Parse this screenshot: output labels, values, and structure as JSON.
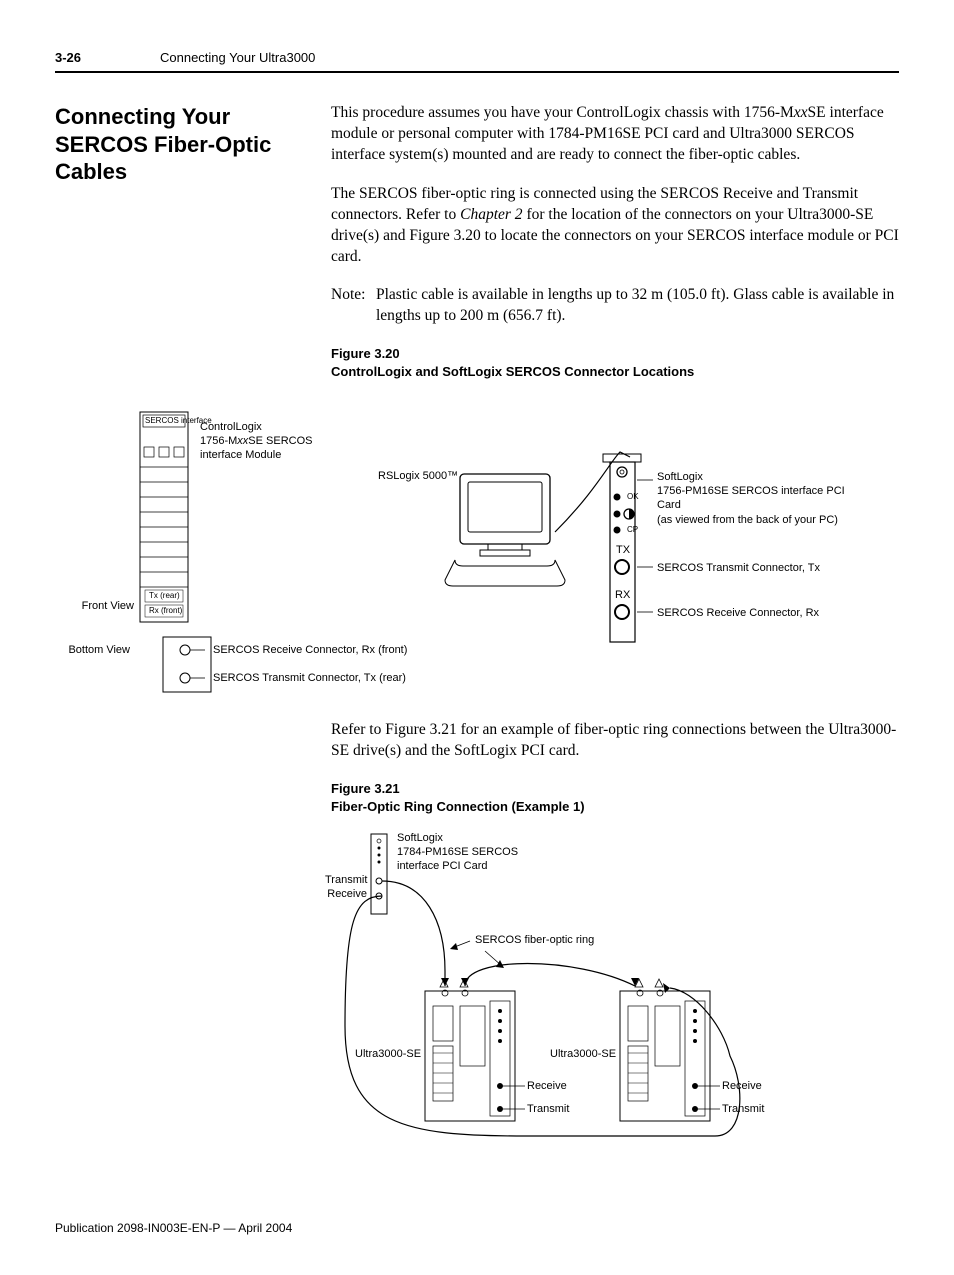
{
  "header": {
    "page_number": "3-26",
    "chapter": "Connecting Your Ultra3000"
  },
  "section_title": "Connecting Your SERCOS Fiber-Optic Cables",
  "para1_a": "This procedure assumes you have your ControlLogix chassis with 1756-M",
  "para1_b": "xx",
  "para1_c": "SE interface module or personal computer with 1784-PM16SE PCI card and Ultra3000 SERCOS interface system(s) mounted and are ready to connect the fiber-optic cables.",
  "para2_a": "The SERCOS fiber-optic ring is connected using the SERCOS Receive and Transmit connectors. Refer to ",
  "para2_b": "Chapter 2",
  "para2_c": " for the location of the connectors on your Ultra3000-SE drive(s) and Figure 3.20 to locate the connectors on your SERCOS interface module or PCI card.",
  "note_label": "Note:",
  "note_text": "Plastic cable is available in lengths up to 32 m (105.0 ft). Glass cable is available in lengths up to 200 m (656.7 ft).",
  "fig320": {
    "num": "Figure 3.20",
    "title": "ControlLogix and SoftLogix SERCOS Connector Locations",
    "sercos_interface": "SERCOS interface",
    "controllogix_a": "ControlLogix",
    "controllogix_b": "1756-M",
    "controllogix_bx": "xx",
    "controllogix_c": "SE SERCOS",
    "controllogix_d": "interface Module",
    "tx_rear": "Tx (rear)",
    "rx_front": "Rx (front)",
    "front_view": "Front View",
    "bottom_view": "Bottom View",
    "rx_label": "SERCOS Receive Connector, Rx (front)",
    "tx_label": "SERCOS Transmit Connector, Tx (rear)",
    "rslogix": "RSLogix 5000™",
    "ok": "OK",
    "cp": "CP",
    "tx": "TX",
    "rx": "RX",
    "softlogix_a": "SoftLogix",
    "softlogix_b": "1756-PM16SE SERCOS interface PCI Card",
    "softlogix_c": "(as viewed from the back of your PC)",
    "sercos_tx": "SERCOS Transmit Connector, Tx",
    "sercos_rx": "SERCOS Receive Connector, Rx"
  },
  "para3": "Refer to Figure 3.21 for an example of fiber-optic ring connections between the Ultra3000-SE drive(s) and the SoftLogix PCI card.",
  "fig321": {
    "num": "Figure 3.21",
    "title": "Fiber-Optic Ring Connection (Example 1)",
    "softlogix_a": "SoftLogix",
    "softlogix_b": "1784-PM16SE SERCOS",
    "softlogix_c": "interface PCI Card",
    "transmit_label": "Transmit",
    "receive_label": "Receive",
    "ring_label": "SERCOS fiber-optic ring",
    "ultra_label": "Ultra3000-SE",
    "receive": "Receive",
    "transmit": "Transmit"
  },
  "footer": "Publication 2098-IN003E-EN-P — April 2004"
}
